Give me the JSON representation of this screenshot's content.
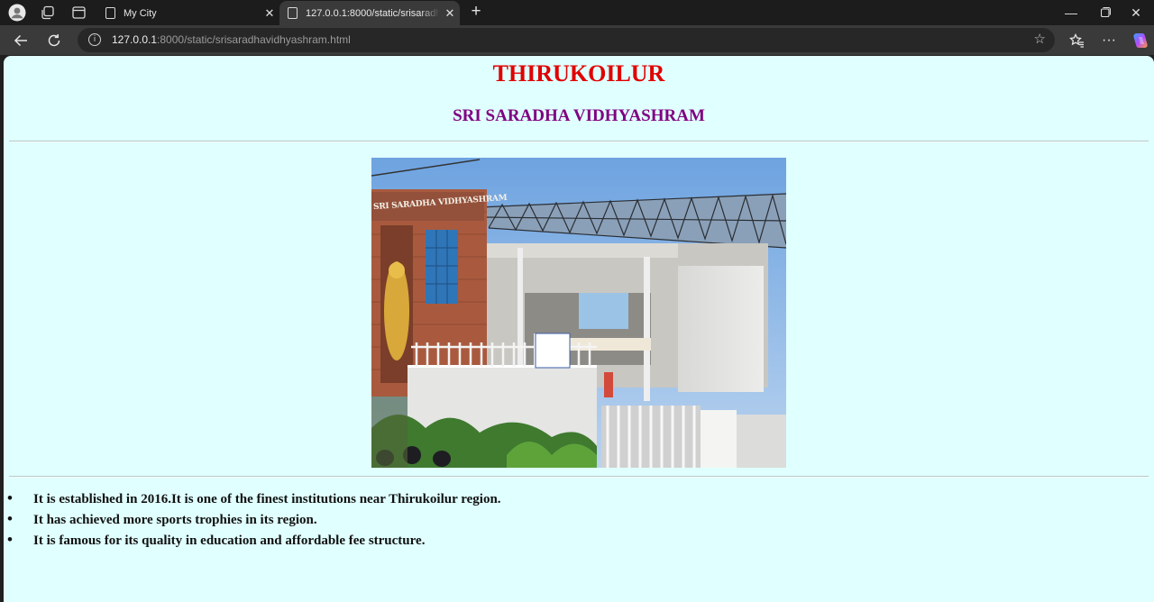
{
  "browser": {
    "tabs": [
      {
        "title": "My City",
        "active": false
      },
      {
        "title": "127.0.0.1:8000/static/srisaradhavidhyashram.html",
        "active": true
      }
    ],
    "url_host": "127.0.0.1",
    "url_rest": ":8000/static/srisaradhavidhyashram.html",
    "icons": {
      "profile": "profile-icon",
      "workspaces": "workspaces-icon",
      "tab_actions": "tab-actions-icon",
      "back": "back-icon",
      "refresh": "refresh-icon",
      "site_info": "info-icon",
      "favorite": "star-icon",
      "favorites_hub": "favorites-icon",
      "more": "more-icon",
      "copilot": "copilot-icon"
    }
  },
  "page": {
    "title": "THIRUKOILUR",
    "subtitle": "SRI SARADHA VIDHYASHRAM",
    "photo_sign": "SRI SARADHA VIDHYASHRAM",
    "bullets": [
      "It is established in 2016.It is one of the finest institutions near Thirukoilur region.",
      "It has achieved more sports trophies in its region.",
      "It is famous for its quality in education and affordable fee structure."
    ],
    "colors": {
      "background": "#e0ffff",
      "title": "#e00000",
      "subtitle": "#800080"
    }
  }
}
